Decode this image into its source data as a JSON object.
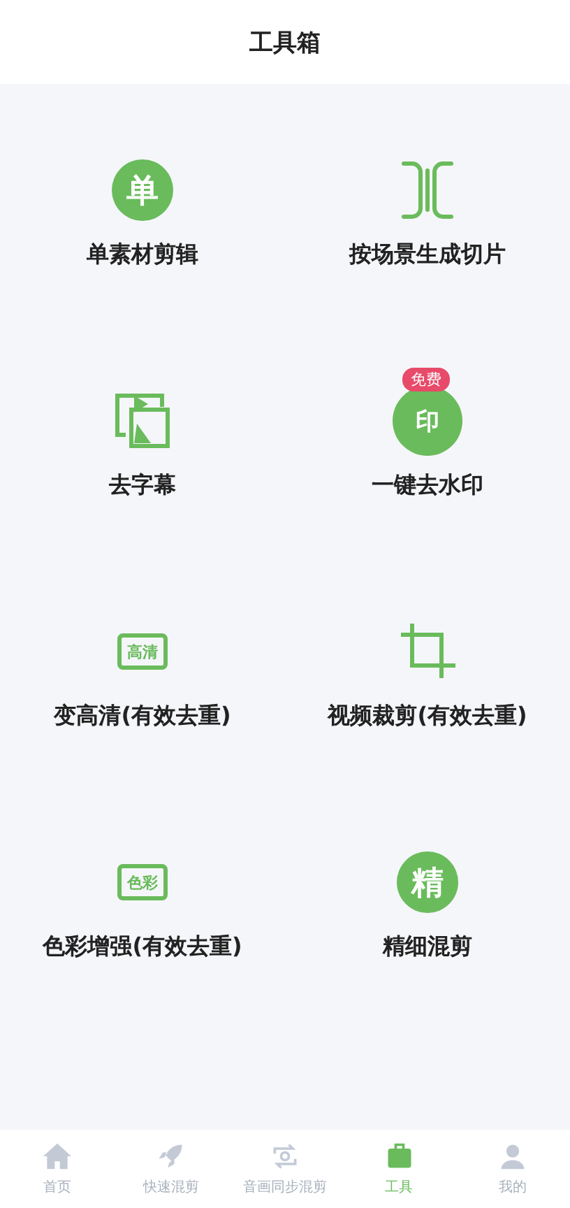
{
  "header": {
    "title": "工具箱"
  },
  "tool_rows": [
    {
      "tools": [
        {
          "label": "单素材剪辑",
          "icon": {
            "kind": "circle",
            "glyph": "单"
          }
        },
        {
          "label": "按场景生成切片",
          "icon": {
            "kind": "split"
          }
        }
      ]
    },
    {
      "tools": [
        {
          "label": "去字幕",
          "icon": {
            "kind": "frames"
          }
        },
        {
          "label": "一键去水印",
          "icon": {
            "kind": "stamp",
            "glyph": "印"
          },
          "badge": "免费"
        }
      ]
    },
    {
      "tools": [
        {
          "label": "变高清(有效去重)",
          "icon": {
            "kind": "boxed",
            "glyph": "高清"
          }
        },
        {
          "label": "视频裁剪(有效去重)",
          "icon": {
            "kind": "crop"
          }
        }
      ]
    },
    {
      "tools": [
        {
          "label": "色彩增强(有效去重)",
          "icon": {
            "kind": "boxed",
            "glyph": "色彩"
          }
        },
        {
          "label": "精细混剪",
          "icon": {
            "kind": "circle",
            "glyph": "精"
          }
        }
      ]
    }
  ],
  "tab_bar": [
    {
      "label": "首页",
      "kind": "home",
      "selected": false
    },
    {
      "label": "快速混剪",
      "kind": "rocket",
      "selected": false
    },
    {
      "label": "音画同步混剪",
      "kind": "sync",
      "selected": false
    },
    {
      "label": "工具",
      "kind": "tools",
      "selected": true
    },
    {
      "label": "我的",
      "kind": "user",
      "selected": false
    }
  ]
}
